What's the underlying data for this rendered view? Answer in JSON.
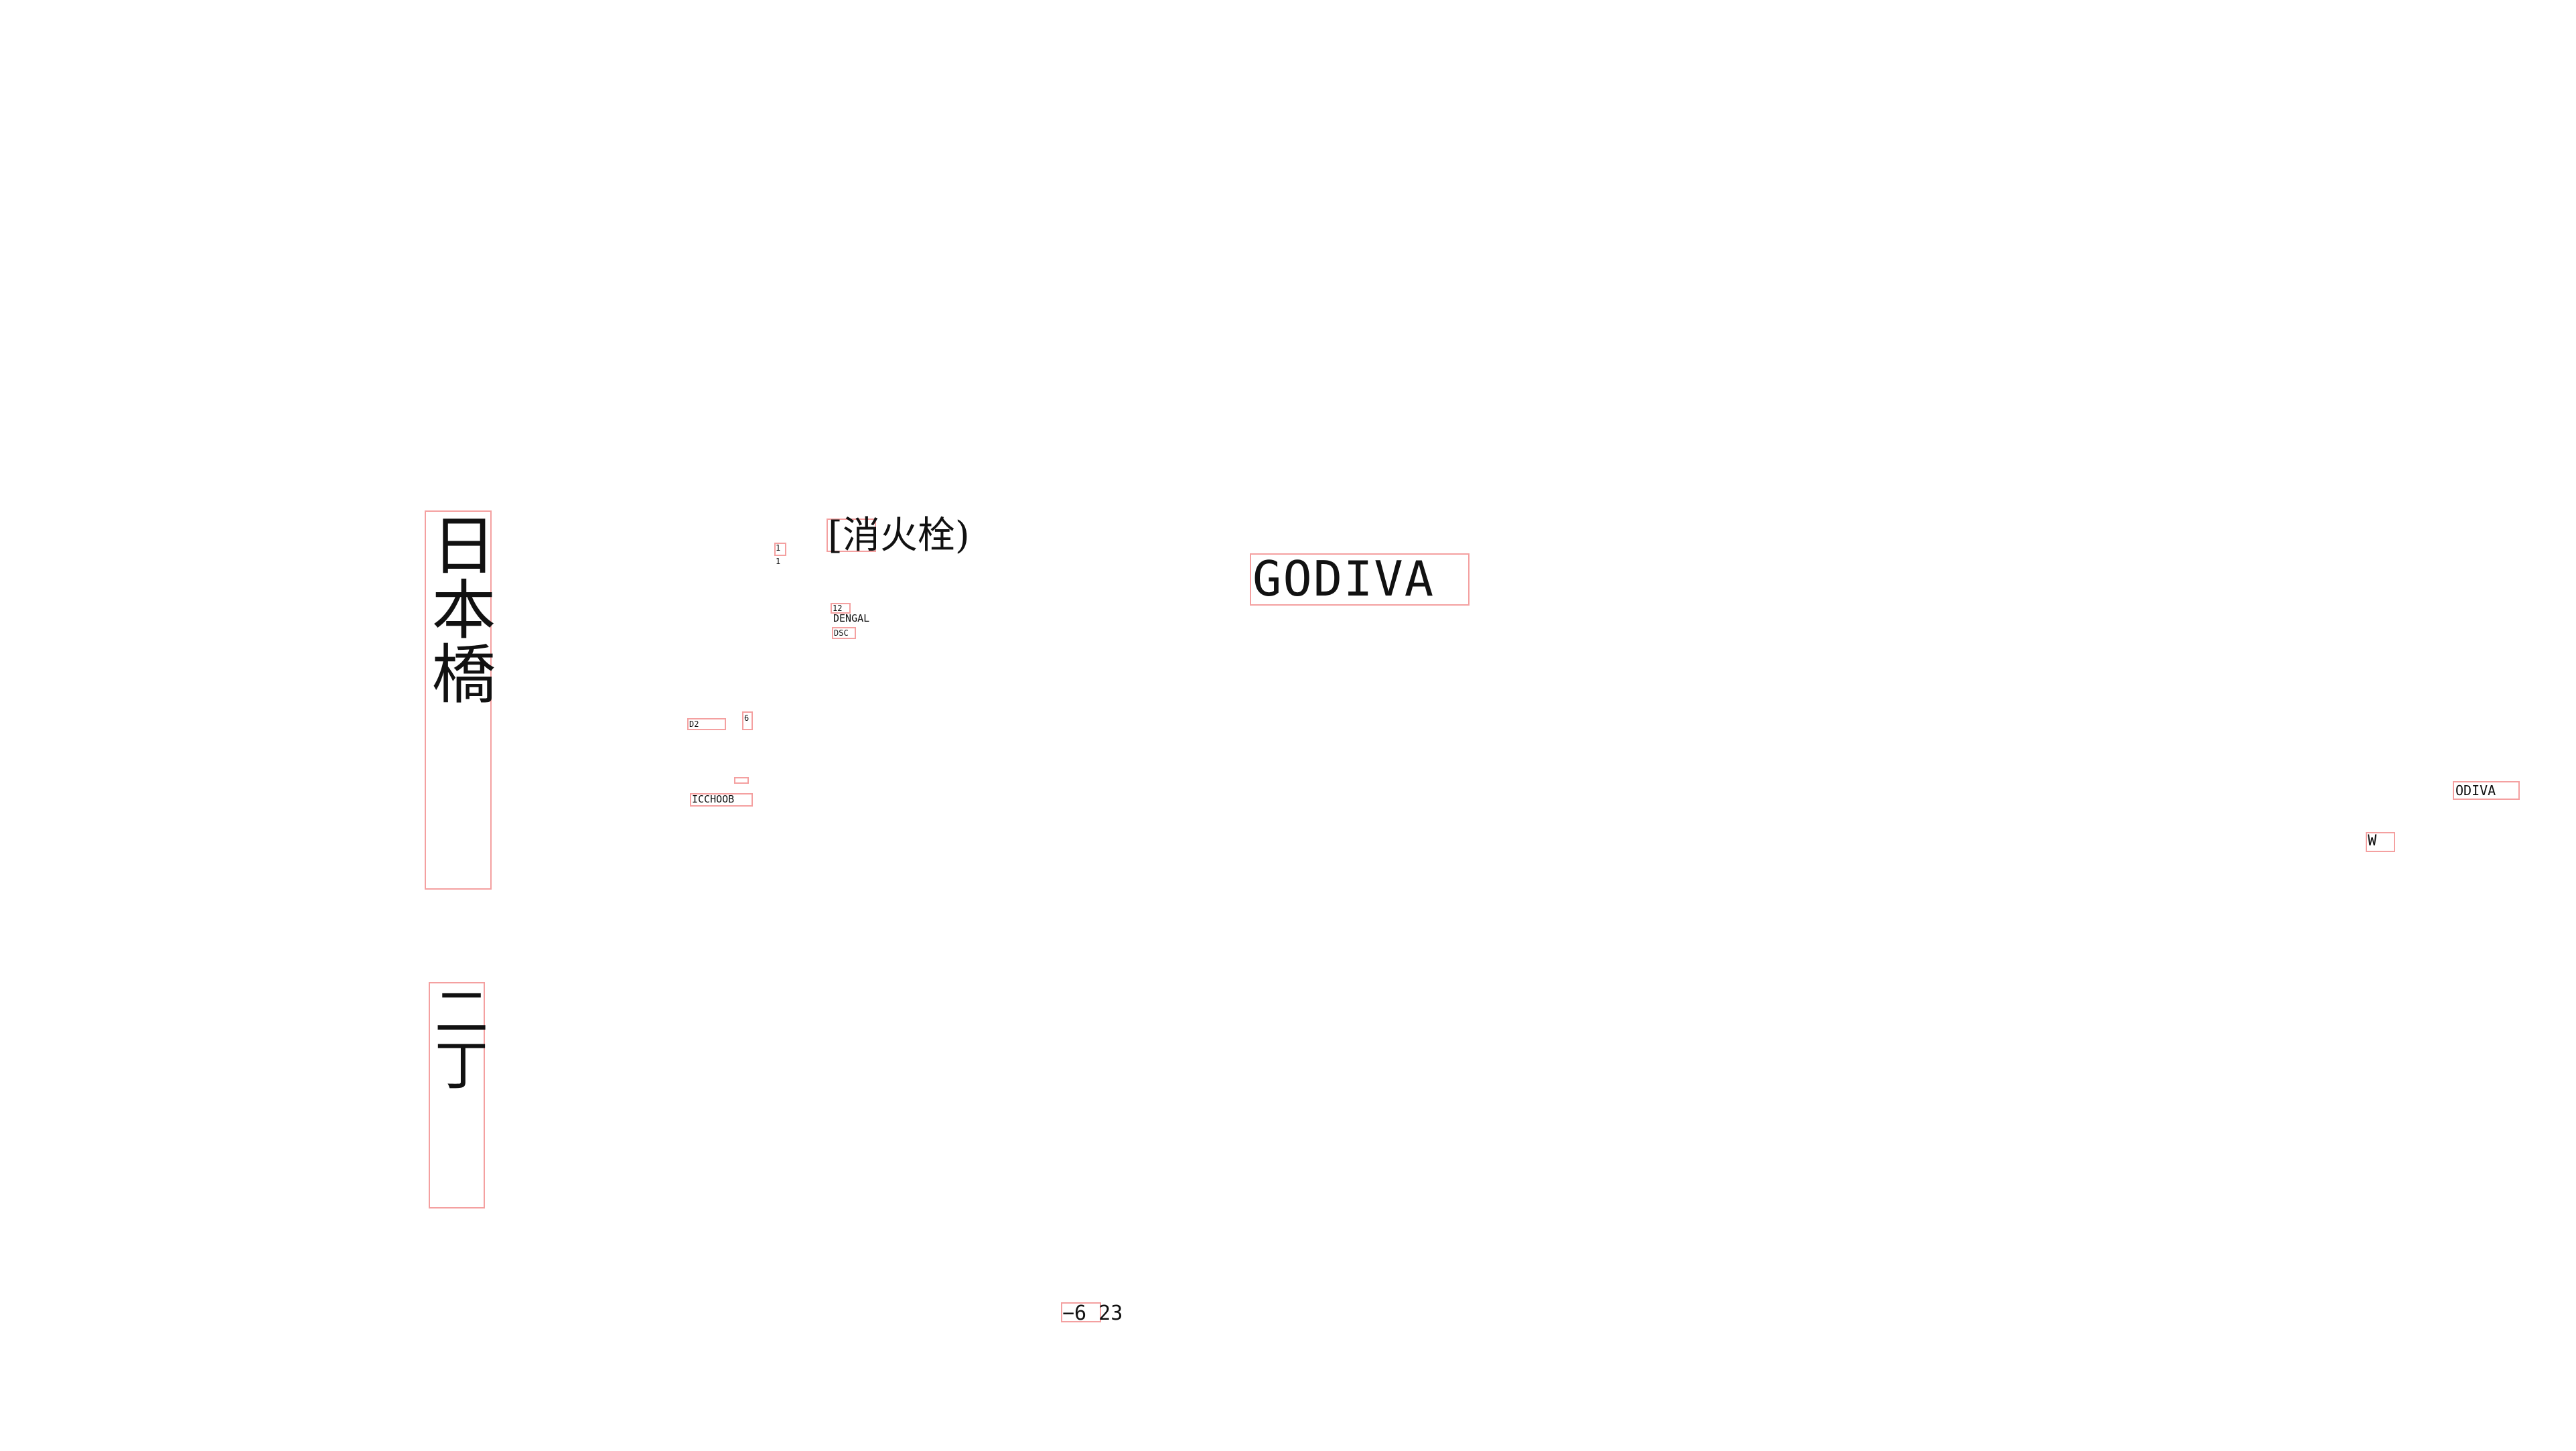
{
  "labels": {
    "vertical_main": "日本橋",
    "vertical_sub": "二丁",
    "hydrant": "[消火栓)",
    "godiva_large": "GODIVA",
    "godiva_small": "ODIVA",
    "w_label": "W",
    "page_number": "−6 23",
    "num_1": "1",
    "num_1b": "1",
    "num_12": "12",
    "sign_dengal": "DENGAL",
    "sign_dsc": "DSC",
    "code_d2": "D2",
    "code_6": "6",
    "sign_icchoob": "ICCHOOB"
  },
  "colors": {
    "box_outline": "#f4a0a0",
    "text": "#111111",
    "background": "#ffffff"
  }
}
